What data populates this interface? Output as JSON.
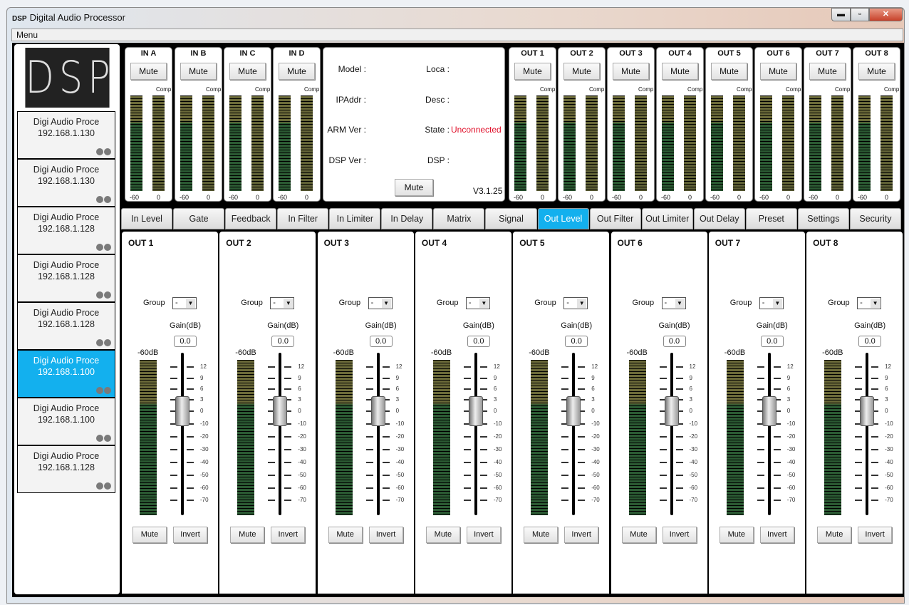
{
  "window": {
    "logo_text": "DSP",
    "title": "Digital Audio Processor",
    "minimize": "▬",
    "maximize": "▫",
    "close": "✕"
  },
  "menu": {
    "label": "Menu"
  },
  "sidebar": {
    "logo": "DSP",
    "devices": [
      {
        "name": "Digi Audio Proce",
        "ip": "192.168.1.130",
        "selected": false
      },
      {
        "name": "Digi Audio Proce",
        "ip": "192.168.1.130",
        "selected": false
      },
      {
        "name": "Digi Audio Proce",
        "ip": "192.168.1.128",
        "selected": false
      },
      {
        "name": "Digi Audio Proce",
        "ip": "192.168.1.128",
        "selected": false
      },
      {
        "name": "Digi Audio Proce",
        "ip": "192.168.1.128",
        "selected": false
      },
      {
        "name": "Digi Audio Proce",
        "ip": "192.168.1.100",
        "selected": true
      },
      {
        "name": "Digi Audio Proce",
        "ip": "192.168.1.100",
        "selected": false
      },
      {
        "name": "Digi Audio Proce",
        "ip": "192.168.1.128",
        "selected": false
      }
    ]
  },
  "meters": {
    "mute": "Mute",
    "comp": "Comp",
    "min": "-60",
    "max": "0",
    "inputs": [
      "IN A",
      "IN B",
      "IN C",
      "IN D"
    ],
    "outputs": [
      "OUT 1",
      "OUT 2",
      "OUT 3",
      "OUT 4",
      "OUT 5",
      "OUT 6",
      "OUT 7",
      "OUT 8"
    ]
  },
  "info": {
    "model": "Model :",
    "ipaddr": "IPAddr :",
    "arm": "ARM Ver :",
    "dspver": "DSP Ver :",
    "loca": "Loca :",
    "desc": "Desc :",
    "state": "State :",
    "state_value": "Unconnected",
    "dsp": "DSP :",
    "mute": "Mute",
    "version": "V3.1.25",
    "state_color": "#e0102a"
  },
  "tabs": [
    {
      "label": "In Level"
    },
    {
      "label": "Gate"
    },
    {
      "label": "Feedback"
    },
    {
      "label": "In Filter"
    },
    {
      "label": "In Limiter"
    },
    {
      "label": "In Delay"
    },
    {
      "label": "Matrix"
    },
    {
      "label": "Signal"
    },
    {
      "label": "Out Level",
      "active": true
    },
    {
      "label": "Out Filter"
    },
    {
      "label": "Out Limiter"
    },
    {
      "label": "Out Delay"
    },
    {
      "label": "Preset"
    },
    {
      "label": "Settings"
    },
    {
      "label": "Security"
    }
  ],
  "strips": {
    "group_label": "Group",
    "group_value": "-",
    "gain_label": "Gain(dB)",
    "meter_label": "-60dB",
    "mute": "Mute",
    "invert": "Invert",
    "scale": [
      "12",
      "9",
      "6",
      "3",
      "0",
      "-10",
      "-20",
      "-30",
      "-40",
      "-50",
      "-60",
      "-70"
    ],
    "channels": [
      {
        "name": "OUT 1",
        "gain": "0.0"
      },
      {
        "name": "OUT 2",
        "gain": "0.0"
      },
      {
        "name": "OUT 3",
        "gain": "0.0"
      },
      {
        "name": "OUT 4",
        "gain": "0.0"
      },
      {
        "name": "OUT 5",
        "gain": "0.0"
      },
      {
        "name": "OUT 6",
        "gain": "0.0"
      },
      {
        "name": "OUT 7",
        "gain": "0.0"
      },
      {
        "name": "OUT 8",
        "gain": "0.0"
      }
    ]
  }
}
